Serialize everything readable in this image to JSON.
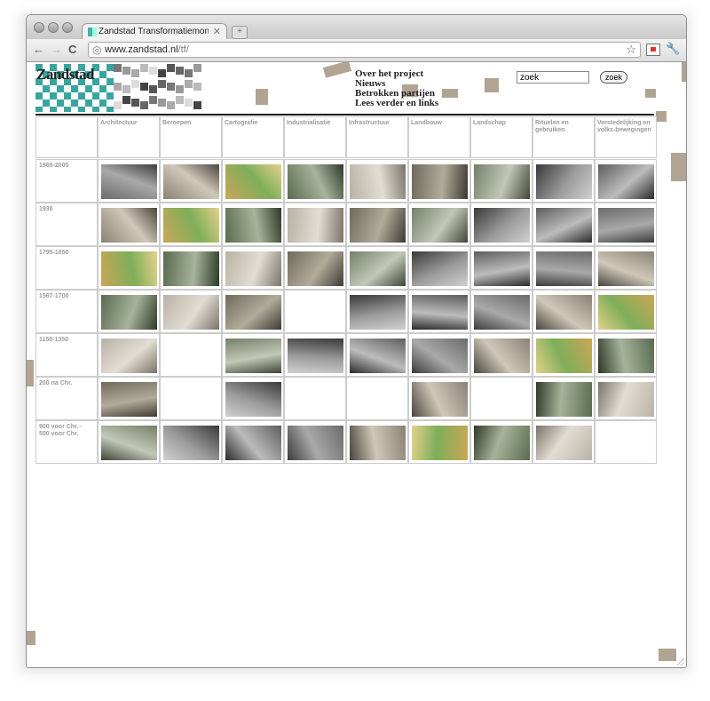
{
  "browser": {
    "tab_title": "Zandstad Transformatiemon",
    "tab_close": "✕",
    "new_tab": "+",
    "url_host": "www.zandstad.nl",
    "url_path": "/tf/",
    "back_icon": "←",
    "forward_icon": "→",
    "reload_icon": "C",
    "star_icon": "☆",
    "wrench_icon": "🔧"
  },
  "site": {
    "logo_text": "Zandstad",
    "menu": [
      "Over het project",
      "Nieuws",
      "Betrokken partijen",
      "Lees verder en links"
    ],
    "search_value": "zoek",
    "search_button": "zoek"
  },
  "table": {
    "columns": [
      "Architectuur",
      "Beroepen",
      "Cartografie",
      "Industrialisatie",
      "Infrastructuur",
      "Landbouw",
      "Landschap",
      "Rituelen en gebruiken",
      "Verstedelijking en volks-bewegingen"
    ],
    "rows": [
      {
        "period": "1965-2005",
        "cells": [
          1,
          1,
          1,
          1,
          1,
          1,
          1,
          1,
          1
        ]
      },
      {
        "period": "1930",
        "cells": [
          1,
          1,
          1,
          1,
          1,
          1,
          1,
          1,
          1
        ]
      },
      {
        "period": "1795-1850",
        "cells": [
          1,
          1,
          1,
          1,
          1,
          1,
          1,
          1,
          1
        ]
      },
      {
        "period": "1567-1700",
        "cells": [
          1,
          1,
          1,
          0,
          1,
          1,
          1,
          1,
          1
        ]
      },
      {
        "period": "1150-1350",
        "cells": [
          1,
          0,
          1,
          1,
          1,
          1,
          1,
          1,
          1
        ]
      },
      {
        "period": "200 na Chr.",
        "cells": [
          1,
          0,
          1,
          0,
          0,
          1,
          0,
          1,
          1
        ]
      },
      {
        "period": "900 voor Chr. - 500 voor Chr.",
        "cells": [
          1,
          1,
          1,
          1,
          1,
          1,
          1,
          1,
          0
        ]
      }
    ]
  },
  "colors": {
    "accent_teal": "#3aa59f",
    "blob": "#a89a86",
    "label_gray": "#9a9a9a"
  }
}
